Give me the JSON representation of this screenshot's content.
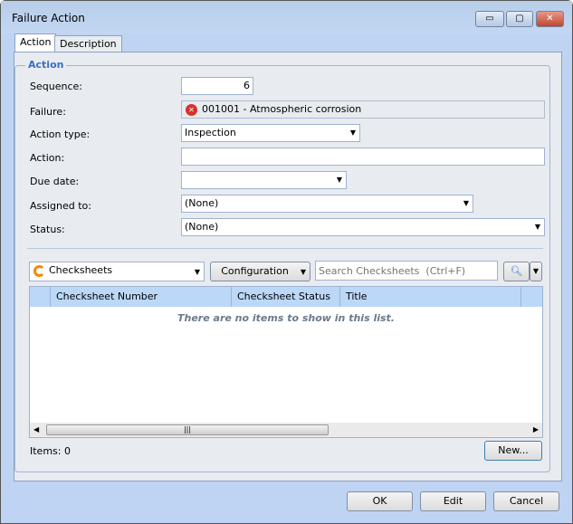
{
  "window": {
    "title": "Failure Action",
    "minimize": "▭",
    "maximize": "▢",
    "close": "✕"
  },
  "tabs": [
    {
      "label": "Action"
    },
    {
      "label": "Description"
    }
  ],
  "group": {
    "title": "Action"
  },
  "form": {
    "sequence": {
      "label": "Sequence:",
      "value": "6"
    },
    "failure": {
      "label": "Failure:",
      "value": "001001 - Atmospheric corrosion"
    },
    "action_type": {
      "label": "Action type:",
      "value": "Inspection"
    },
    "action": {
      "label": "Action:",
      "value": ""
    },
    "due_date": {
      "label": "Due date:",
      "value": ""
    },
    "assigned_to": {
      "label": "Assigned to:",
      "value": "(None)"
    },
    "status": {
      "label": "Status:",
      "value": "(None)"
    }
  },
  "list": {
    "view_select": "Checksheets",
    "configuration": "Configuration",
    "search_placeholder": "Search Checksheets  (Ctrl+F)",
    "columns": [
      "Checksheet Number",
      "Checksheet Status",
      "Title"
    ],
    "empty_message": "There are no items to show in this list.",
    "items_count": "Items: 0",
    "new_button": "New..."
  },
  "footer": {
    "ok": "OK",
    "edit": "Edit",
    "cancel": "Cancel"
  }
}
